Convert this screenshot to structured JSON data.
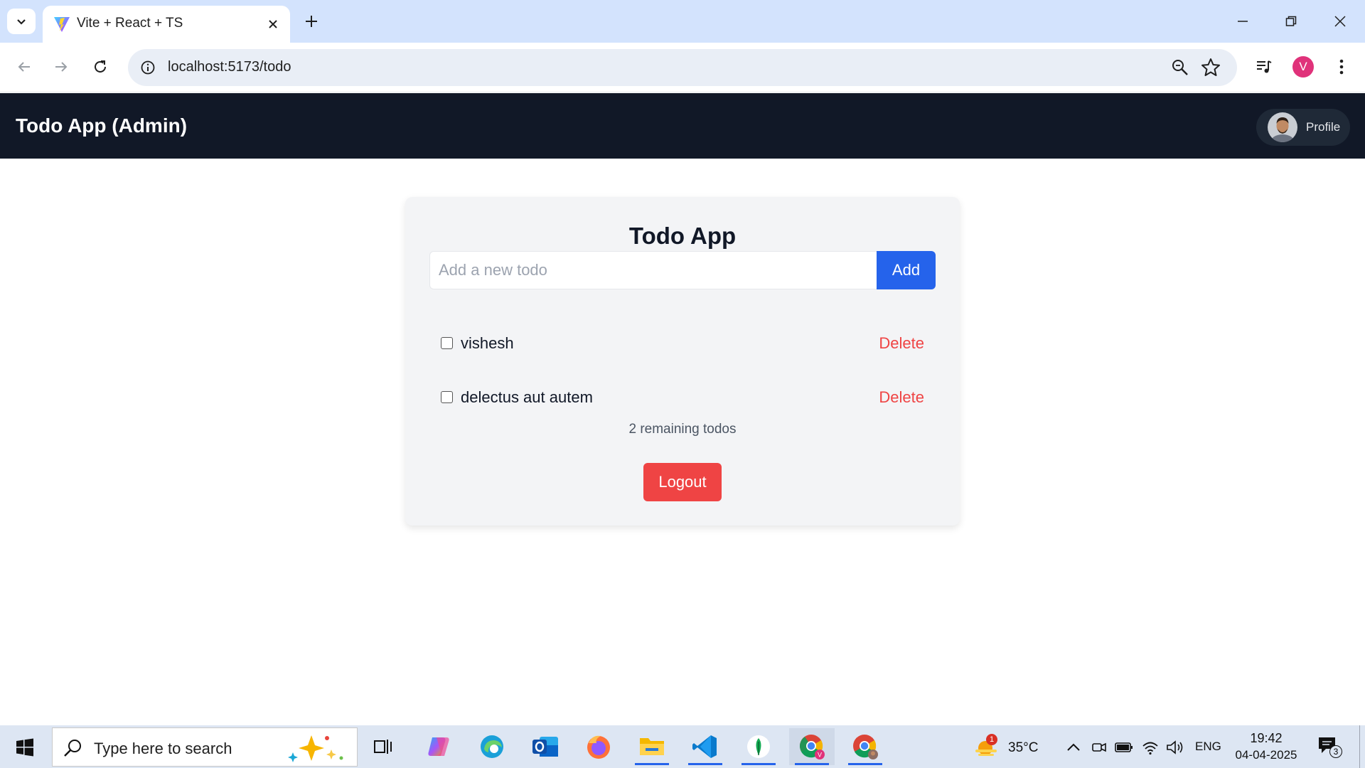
{
  "browser": {
    "tab_title": "Vite + React + TS",
    "url": "localhost:5173/todo",
    "profile_initial": "V"
  },
  "header": {
    "title": "Todo App (Admin)",
    "profile_label": "Profile"
  },
  "todo": {
    "title": "Todo App",
    "input_placeholder": "Add a new todo",
    "input_value": "",
    "add_label": "Add",
    "items": [
      {
        "text": "vishesh",
        "done": false,
        "delete_label": "Delete"
      },
      {
        "text": "delectus aut autem",
        "done": false,
        "delete_label": "Delete"
      }
    ],
    "remaining": "2 remaining todos",
    "logout_label": "Logout"
  },
  "taskbar": {
    "search_placeholder": "Type here to search",
    "weather_badge": "1",
    "temperature": "35°C",
    "language": "ENG",
    "time": "19:42",
    "date": "04-04-2025",
    "notification_count": "3"
  },
  "colors": {
    "header_bg": "#111827",
    "accent": "#2563eb",
    "danger": "#ef4444",
    "card_bg": "#f3f4f6"
  }
}
